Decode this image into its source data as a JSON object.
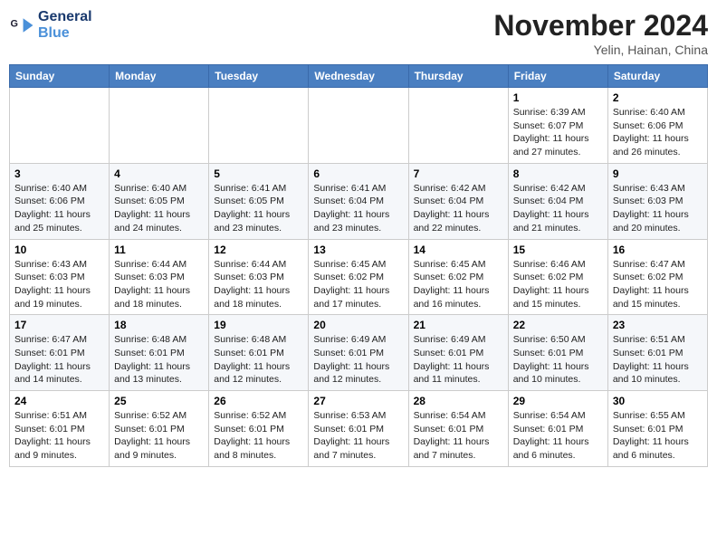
{
  "logo": {
    "line1": "General",
    "line2": "Blue"
  },
  "title": "November 2024",
  "location": "Yelin, Hainan, China",
  "weekdays": [
    "Sunday",
    "Monday",
    "Tuesday",
    "Wednesday",
    "Thursday",
    "Friday",
    "Saturday"
  ],
  "weeks": [
    [
      {
        "day": "",
        "info": ""
      },
      {
        "day": "",
        "info": ""
      },
      {
        "day": "",
        "info": ""
      },
      {
        "day": "",
        "info": ""
      },
      {
        "day": "",
        "info": ""
      },
      {
        "day": "1",
        "info": "Sunrise: 6:39 AM\nSunset: 6:07 PM\nDaylight: 11 hours and 27 minutes."
      },
      {
        "day": "2",
        "info": "Sunrise: 6:40 AM\nSunset: 6:06 PM\nDaylight: 11 hours and 26 minutes."
      }
    ],
    [
      {
        "day": "3",
        "info": "Sunrise: 6:40 AM\nSunset: 6:06 PM\nDaylight: 11 hours and 25 minutes."
      },
      {
        "day": "4",
        "info": "Sunrise: 6:40 AM\nSunset: 6:05 PM\nDaylight: 11 hours and 24 minutes."
      },
      {
        "day": "5",
        "info": "Sunrise: 6:41 AM\nSunset: 6:05 PM\nDaylight: 11 hours and 23 minutes."
      },
      {
        "day": "6",
        "info": "Sunrise: 6:41 AM\nSunset: 6:04 PM\nDaylight: 11 hours and 23 minutes."
      },
      {
        "day": "7",
        "info": "Sunrise: 6:42 AM\nSunset: 6:04 PM\nDaylight: 11 hours and 22 minutes."
      },
      {
        "day": "8",
        "info": "Sunrise: 6:42 AM\nSunset: 6:04 PM\nDaylight: 11 hours and 21 minutes."
      },
      {
        "day": "9",
        "info": "Sunrise: 6:43 AM\nSunset: 6:03 PM\nDaylight: 11 hours and 20 minutes."
      }
    ],
    [
      {
        "day": "10",
        "info": "Sunrise: 6:43 AM\nSunset: 6:03 PM\nDaylight: 11 hours and 19 minutes."
      },
      {
        "day": "11",
        "info": "Sunrise: 6:44 AM\nSunset: 6:03 PM\nDaylight: 11 hours and 18 minutes."
      },
      {
        "day": "12",
        "info": "Sunrise: 6:44 AM\nSunset: 6:03 PM\nDaylight: 11 hours and 18 minutes."
      },
      {
        "day": "13",
        "info": "Sunrise: 6:45 AM\nSunset: 6:02 PM\nDaylight: 11 hours and 17 minutes."
      },
      {
        "day": "14",
        "info": "Sunrise: 6:45 AM\nSunset: 6:02 PM\nDaylight: 11 hours and 16 minutes."
      },
      {
        "day": "15",
        "info": "Sunrise: 6:46 AM\nSunset: 6:02 PM\nDaylight: 11 hours and 15 minutes."
      },
      {
        "day": "16",
        "info": "Sunrise: 6:47 AM\nSunset: 6:02 PM\nDaylight: 11 hours and 15 minutes."
      }
    ],
    [
      {
        "day": "17",
        "info": "Sunrise: 6:47 AM\nSunset: 6:01 PM\nDaylight: 11 hours and 14 minutes."
      },
      {
        "day": "18",
        "info": "Sunrise: 6:48 AM\nSunset: 6:01 PM\nDaylight: 11 hours and 13 minutes."
      },
      {
        "day": "19",
        "info": "Sunrise: 6:48 AM\nSunset: 6:01 PM\nDaylight: 11 hours and 12 minutes."
      },
      {
        "day": "20",
        "info": "Sunrise: 6:49 AM\nSunset: 6:01 PM\nDaylight: 11 hours and 12 minutes."
      },
      {
        "day": "21",
        "info": "Sunrise: 6:49 AM\nSunset: 6:01 PM\nDaylight: 11 hours and 11 minutes."
      },
      {
        "day": "22",
        "info": "Sunrise: 6:50 AM\nSunset: 6:01 PM\nDaylight: 11 hours and 10 minutes."
      },
      {
        "day": "23",
        "info": "Sunrise: 6:51 AM\nSunset: 6:01 PM\nDaylight: 11 hours and 10 minutes."
      }
    ],
    [
      {
        "day": "24",
        "info": "Sunrise: 6:51 AM\nSunset: 6:01 PM\nDaylight: 11 hours and 9 minutes."
      },
      {
        "day": "25",
        "info": "Sunrise: 6:52 AM\nSunset: 6:01 PM\nDaylight: 11 hours and 9 minutes."
      },
      {
        "day": "26",
        "info": "Sunrise: 6:52 AM\nSunset: 6:01 PM\nDaylight: 11 hours and 8 minutes."
      },
      {
        "day": "27",
        "info": "Sunrise: 6:53 AM\nSunset: 6:01 PM\nDaylight: 11 hours and 7 minutes."
      },
      {
        "day": "28",
        "info": "Sunrise: 6:54 AM\nSunset: 6:01 PM\nDaylight: 11 hours and 7 minutes."
      },
      {
        "day": "29",
        "info": "Sunrise: 6:54 AM\nSunset: 6:01 PM\nDaylight: 11 hours and 6 minutes."
      },
      {
        "day": "30",
        "info": "Sunrise: 6:55 AM\nSunset: 6:01 PM\nDaylight: 11 hours and 6 minutes."
      }
    ]
  ]
}
